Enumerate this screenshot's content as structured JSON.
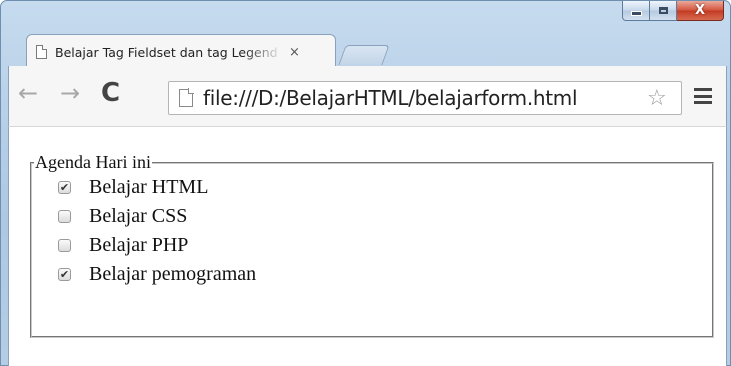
{
  "tab": {
    "title": "Belajar Tag Fieldset dan tag Legend",
    "close_glyph": "×"
  },
  "toolbar": {
    "back_glyph": "←",
    "forward_glyph": "→",
    "reload_glyph": "C",
    "url": "file:///D:/BelajarHTML/belajarform.html",
    "star_glyph": "☆"
  },
  "window_controls": {
    "close_glyph": "X"
  },
  "icons": [
    "page-icon",
    "back-arrow-icon",
    "forward-arrow-icon",
    "reload-icon",
    "star-icon",
    "menu-icon",
    "minimize-icon",
    "maximize-icon",
    "close-icon"
  ],
  "fieldset": {
    "legend": "Agenda Hari ini",
    "options": [
      {
        "label": "Belajar HTML",
        "checked": true
      },
      {
        "label": "Belajar CSS",
        "checked": false
      },
      {
        "label": "Belajar PHP",
        "checked": false
      },
      {
        "label": "Belajar pemograman",
        "checked": true
      }
    ]
  },
  "colors": {
    "frame": "#b8d0e8",
    "close_button": "#c23a22",
    "toolbar": "#f6f6f6"
  }
}
